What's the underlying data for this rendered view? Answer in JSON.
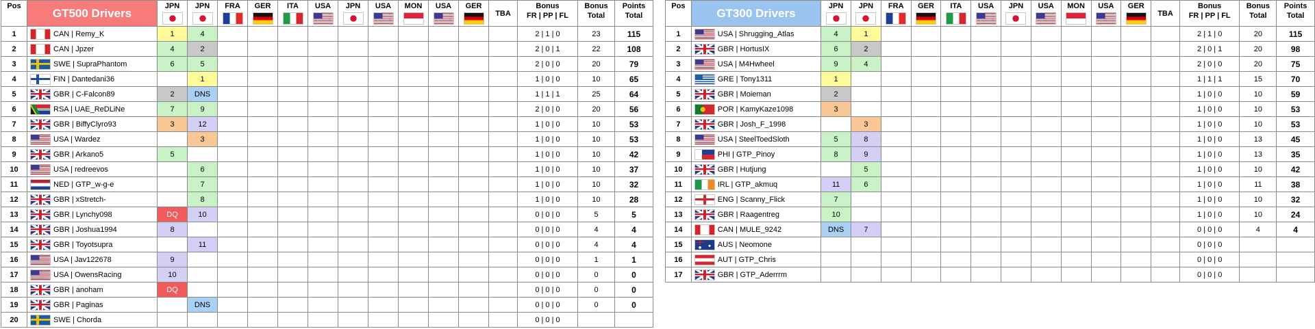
{
  "headers": {
    "pos": "Pos",
    "bonus": [
      "Bonus",
      "FR | PP | FL"
    ],
    "bonus_total": [
      "Bonus",
      "Total"
    ],
    "points_total": [
      "Points",
      "Total"
    ],
    "tba": "TBA"
  },
  "races": [
    {
      "label": "JPN",
      "flag": "jpn"
    },
    {
      "label": "JPN",
      "flag": "jpn"
    },
    {
      "label": "FRA",
      "flag": "fra"
    },
    {
      "label": "GER",
      "flag": "ger"
    },
    {
      "label": "ITA",
      "flag": "ita"
    },
    {
      "label": "USA",
      "flag": "usa"
    },
    {
      "label": "JPN",
      "flag": "jpn"
    },
    {
      "label": "USA",
      "flag": "usa"
    },
    {
      "label": "MON",
      "flag": "mon"
    },
    {
      "label": "USA",
      "flag": "usa"
    },
    {
      "label": "GER",
      "flag": "ger"
    }
  ],
  "colors": {
    "gt500_title_bg": "#f87b7b",
    "gt300_title_bg": "#9ac3f0",
    "win": "#fffb9a",
    "second": "#c8c8c8",
    "third": "#f9c896",
    "points": "#c9f2c6",
    "no_points": "#d4d0f5",
    "dq": "#f25b5b",
    "dns": "#a9d0f5"
  },
  "gt500": {
    "title": "GT500 Drivers",
    "rows": [
      {
        "pos": "1",
        "flag": "can",
        "driver": "CAN | Remy_K",
        "r1": "1",
        "r1c": "win",
        "r2": "4",
        "r2c": "pts",
        "bonus": "2 | 1 | 0",
        "bonus_total": "23",
        "points_total": "115"
      },
      {
        "pos": "2",
        "flag": "can",
        "driver": "CAN | Jpzer",
        "r1": "4",
        "r1c": "pts",
        "r2": "2",
        "r2c": "p2",
        "bonus": "2 | 0 | 1",
        "bonus_total": "22",
        "points_total": "108"
      },
      {
        "pos": "3",
        "flag": "swe",
        "driver": "SWE | SupraPhantom",
        "r1": "6",
        "r1c": "pts",
        "r2": "5",
        "r2c": "pts",
        "bonus": "2 | 0 | 0",
        "bonus_total": "20",
        "points_total": "79"
      },
      {
        "pos": "4",
        "flag": "fin",
        "driver": "FIN | Dantedani36",
        "r1": "",
        "r1c": "",
        "r2": "1",
        "r2c": "win",
        "bonus": "1 | 0 | 0",
        "bonus_total": "10",
        "points_total": "65"
      },
      {
        "pos": "5",
        "flag": "gbr",
        "driver": "GBR | C-Falcon89",
        "r1": "2",
        "r1c": "p2",
        "r2": "DNS",
        "r2c": "dns",
        "bonus": "1 | 1 | 1",
        "bonus_total": "25",
        "points_total": "64"
      },
      {
        "pos": "6",
        "flag": "rsa",
        "driver": "RSA | UAE_ReDLiNe",
        "r1": "7",
        "r1c": "pts",
        "r2": "9",
        "r2c": "pts",
        "bonus": "2 | 0 | 0",
        "bonus_total": "20",
        "points_total": "56"
      },
      {
        "pos": "7",
        "flag": "gbr",
        "driver": "GBR | BiffyClyro93",
        "r1": "3",
        "r1c": "p3",
        "r2": "12",
        "r2c": "nopts",
        "bonus": "1 | 0 | 0",
        "bonus_total": "10",
        "points_total": "53"
      },
      {
        "pos": "8",
        "flag": "usa",
        "driver": "USA | Wardez",
        "r1": "",
        "r1c": "",
        "r2": "3",
        "r2c": "p3",
        "bonus": "1 | 0 | 0",
        "bonus_total": "10",
        "points_total": "53"
      },
      {
        "pos": "9",
        "flag": "gbr",
        "driver": "GBR | Arkano5",
        "r1": "5",
        "r1c": "pts",
        "r2": "",
        "r2c": "",
        "bonus": "1 | 0 | 0",
        "bonus_total": "10",
        "points_total": "42"
      },
      {
        "pos": "10",
        "flag": "usa",
        "driver": "USA | redreevos",
        "r1": "",
        "r1c": "",
        "r2": "6",
        "r2c": "pts",
        "bonus": "1 | 0 | 0",
        "bonus_total": "10",
        "points_total": "37"
      },
      {
        "pos": "11",
        "flag": "ned",
        "driver": "NED | GTP_w-g-e",
        "r1": "",
        "r1c": "",
        "r2": "7",
        "r2c": "pts",
        "bonus": "1 | 0 | 0",
        "bonus_total": "10",
        "points_total": "32"
      },
      {
        "pos": "12",
        "flag": "gbr",
        "driver": "GBR | xStretch-",
        "r1": "",
        "r1c": "",
        "r2": "8",
        "r2c": "pts",
        "bonus": "1 | 0 | 0",
        "bonus_total": "10",
        "points_total": "28"
      },
      {
        "pos": "13",
        "flag": "gbr",
        "driver": "GBR | Lynchy098",
        "r1": "DQ",
        "r1c": "dq",
        "r2": "10",
        "r2c": "nopts",
        "bonus": "0 | 0 | 0",
        "bonus_total": "5",
        "points_total": "5"
      },
      {
        "pos": "14",
        "flag": "gbr",
        "driver": "GBR | Joshua1994",
        "r1": "8",
        "r1c": "nopts",
        "r2": "",
        "r2c": "",
        "bonus": "0 | 0 | 0",
        "bonus_total": "4",
        "points_total": "4"
      },
      {
        "pos": "15",
        "flag": "gbr",
        "driver": "GBR | Toyotsupra",
        "r1": "",
        "r1c": "",
        "r2": "11",
        "r2c": "nopts",
        "bonus": "0 | 0 | 0",
        "bonus_total": "4",
        "points_total": "4"
      },
      {
        "pos": "16",
        "flag": "usa",
        "driver": "USA | Jav122678",
        "r1": "9",
        "r1c": "nopts",
        "r2": "",
        "r2c": "",
        "bonus": "0 | 0 | 0",
        "bonus_total": "1",
        "points_total": "1"
      },
      {
        "pos": "17",
        "flag": "usa",
        "driver": "USA | OwensRacing",
        "r1": "10",
        "r1c": "nopts",
        "r2": "",
        "r2c": "",
        "bonus": "0 | 0 | 0",
        "bonus_total": "0",
        "points_total": "0"
      },
      {
        "pos": "18",
        "flag": "gbr",
        "driver": "GBR | anoham",
        "r1": "DQ",
        "r1c": "dq",
        "r2": "",
        "r2c": "",
        "bonus": "0 | 0 | 0",
        "bonus_total": "0",
        "points_total": "0"
      },
      {
        "pos": "19",
        "flag": "gbr",
        "driver": "GBR | Paginas",
        "r1": "",
        "r1c": "",
        "r2": "DNS",
        "r2c": "dns",
        "bonus": "0 | 0 | 0",
        "bonus_total": "0",
        "points_total": "0"
      },
      {
        "pos": "20",
        "flag": "swe",
        "driver": "SWE | Chorda",
        "r1": "",
        "r1c": "",
        "r2": "",
        "r2c": "",
        "bonus": "0 | 0 | 0",
        "bonus_total": "",
        "points_total": ""
      }
    ]
  },
  "gt300": {
    "title": "GT300 Drivers",
    "rows": [
      {
        "pos": "1",
        "flag": "usa",
        "driver": "USA | Shrugging_Atlas",
        "r1": "4",
        "r1c": "pts",
        "r2": "1",
        "r2c": "win",
        "bonus": "2 | 1 | 0",
        "bonus_total": "20",
        "points_total": "115"
      },
      {
        "pos": "2",
        "flag": "gbr",
        "driver": "GBR | HortusIX",
        "r1": "6",
        "r1c": "pts",
        "r2": "2",
        "r2c": "p2",
        "bonus": "2 | 0 | 1",
        "bonus_total": "20",
        "points_total": "98"
      },
      {
        "pos": "3",
        "flag": "usa",
        "driver": "USA | M4Hwheel",
        "r1": "9",
        "r1c": "pts",
        "r2": "4",
        "r2c": "pts",
        "bonus": "2 | 0 | 0",
        "bonus_total": "20",
        "points_total": "75"
      },
      {
        "pos": "4",
        "flag": "gre",
        "driver": "GRE | Tony1311",
        "r1": "1",
        "r1c": "win",
        "r2": "",
        "r2c": "",
        "bonus": "1 | 1 | 1",
        "bonus_total": "15",
        "points_total": "70"
      },
      {
        "pos": "5",
        "flag": "gbr",
        "driver": "GBR | Moieman",
        "r1": "2",
        "r1c": "p2",
        "r2": "",
        "r2c": "",
        "bonus": "1 | 0 | 0",
        "bonus_total": "10",
        "points_total": "59"
      },
      {
        "pos": "6",
        "flag": "por",
        "driver": "POR | KamyKaze1098",
        "r1": "3",
        "r1c": "p3",
        "r2": "",
        "r2c": "",
        "bonus": "1 | 0 | 0",
        "bonus_total": "10",
        "points_total": "53"
      },
      {
        "pos": "7",
        "flag": "gbr",
        "driver": "GBR | Josh_F_1998",
        "r1": "",
        "r1c": "",
        "r2": "3",
        "r2c": "p3",
        "bonus": "1 | 0 | 0",
        "bonus_total": "10",
        "points_total": "53"
      },
      {
        "pos": "8",
        "flag": "usa",
        "driver": "USA | SteelToedSloth",
        "r1": "5",
        "r1c": "pts",
        "r2": "8",
        "r2c": "nopts",
        "bonus": "1 | 0 | 0",
        "bonus_total": "13",
        "points_total": "45"
      },
      {
        "pos": "9",
        "flag": "phi",
        "driver": "PHI | GTP_Pinoy",
        "r1": "8",
        "r1c": "pts",
        "r2": "9",
        "r2c": "nopts",
        "bonus": "1 | 0 | 0",
        "bonus_total": "13",
        "points_total": "35"
      },
      {
        "pos": "10",
        "flag": "gbr",
        "driver": "GBR | Hutjung",
        "r1": "",
        "r1c": "",
        "r2": "5",
        "r2c": "pts",
        "bonus": "1 | 0 | 0",
        "bonus_total": "10",
        "points_total": "42"
      },
      {
        "pos": "11",
        "flag": "irl",
        "driver": "IRL | GTP_akmuq",
        "r1": "11",
        "r1c": "nopts",
        "r2": "6",
        "r2c": "pts",
        "bonus": "1 | 0 | 0",
        "bonus_total": "11",
        "points_total": "38"
      },
      {
        "pos": "12",
        "flag": "eng",
        "driver": "ENG | Scanny_Flick",
        "r1": "7",
        "r1c": "pts",
        "r2": "",
        "r2c": "",
        "bonus": "1 | 0 | 0",
        "bonus_total": "10",
        "points_total": "32"
      },
      {
        "pos": "13",
        "flag": "gbr",
        "driver": "GBR | Raagentreg",
        "r1": "10",
        "r1c": "pts",
        "r2": "",
        "r2c": "",
        "bonus": "1 | 0 | 0",
        "bonus_total": "10",
        "points_total": "24"
      },
      {
        "pos": "14",
        "flag": "can",
        "driver": "CAN | MULE_9242",
        "r1": "DNS",
        "r1c": "dns",
        "r2": "7",
        "r2c": "nopts",
        "bonus": "0 | 0 | 0",
        "bonus_total": "4",
        "points_total": "4"
      },
      {
        "pos": "15",
        "flag": "aus",
        "driver": "AUS | Neomone",
        "r1": "",
        "r1c": "",
        "r2": "",
        "r2c": "",
        "bonus": "0 | 0 | 0",
        "bonus_total": "",
        "points_total": ""
      },
      {
        "pos": "16",
        "flag": "aut",
        "driver": "AUT | GTP_Chris",
        "r1": "",
        "r1c": "",
        "r2": "",
        "r2c": "",
        "bonus": "0 | 0 | 0",
        "bonus_total": "",
        "points_total": ""
      },
      {
        "pos": "17",
        "flag": "gbr",
        "driver": "GBR | GTP_Aderrrm",
        "r1": "",
        "r1c": "",
        "r2": "",
        "r2c": "",
        "bonus": "0 | 0 | 0",
        "bonus_total": "",
        "points_total": ""
      }
    ]
  }
}
